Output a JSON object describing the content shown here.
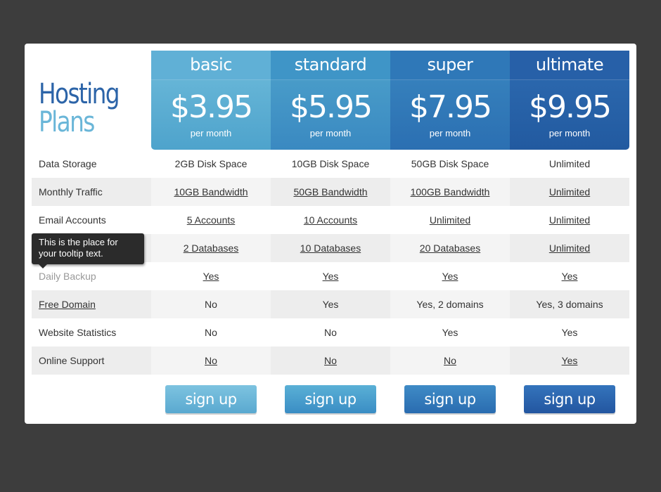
{
  "title": {
    "line1": "Hosting",
    "line2": "Plans"
  },
  "plans": [
    {
      "name": "basic",
      "price": "$3.95",
      "period": "per month",
      "signup_label": "sign up"
    },
    {
      "name": "standard",
      "price": "$5.95",
      "period": "per month",
      "signup_label": "sign up"
    },
    {
      "name": "super",
      "price": "$7.95",
      "period": "per month",
      "signup_label": "sign up"
    },
    {
      "name": "ultimate",
      "price": "$9.95",
      "period": "per month",
      "signup_label": "sign up"
    }
  ],
  "features": [
    {
      "label": "Data Storage",
      "values": [
        "2GB Disk Space",
        "10GB Disk Space",
        "50GB Disk Space",
        "Unlimited"
      ]
    },
    {
      "label": "Monthly Traffic",
      "values": [
        "10GB Bandwidth",
        "50GB Bandwidth",
        "100GB Bandwidth",
        "Unlimited"
      ]
    },
    {
      "label": "Email Accounts",
      "values": [
        "5 Accounts",
        "10 Accounts",
        "Unlimited",
        "Unlimited"
      ]
    },
    {
      "label": "",
      "values": [
        "2 Databases",
        "10 Databases",
        "20 Databases",
        "Unlimited"
      ]
    },
    {
      "label": "Daily Backup",
      "values": [
        "Yes",
        "Yes",
        "Yes",
        "Yes"
      ]
    },
    {
      "label": "Free Domain",
      "values": [
        "No",
        "Yes",
        "Yes, 2 domains",
        "Yes, 3 domains"
      ]
    },
    {
      "label": "Website Statistics",
      "values": [
        "No",
        "No",
        "Yes",
        "Yes"
      ]
    },
    {
      "label": "Online Support",
      "values": [
        "No",
        "No",
        "No",
        "Yes"
      ]
    }
  ],
  "tooltip": {
    "text": "This is the place for your tooltip text."
  }
}
